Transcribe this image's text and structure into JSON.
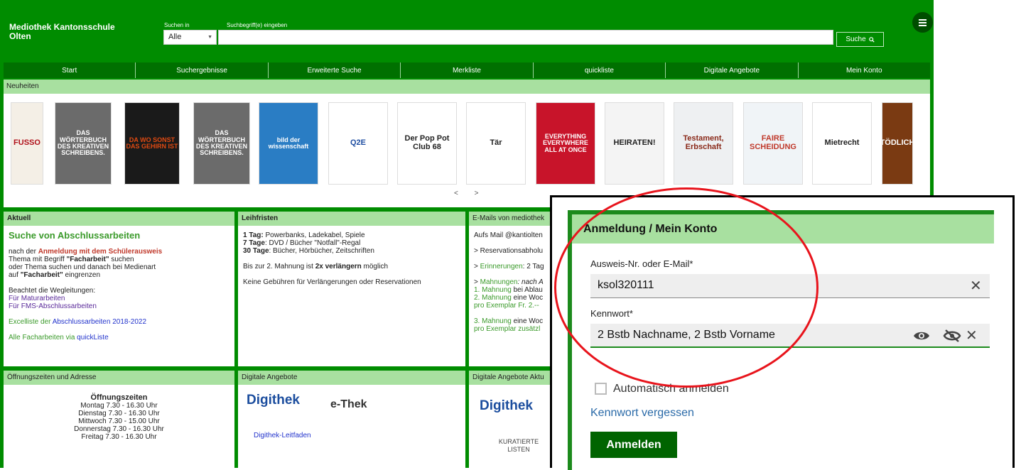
{
  "brand": "Mediothek Kantonsschule Olten",
  "search": {
    "scope_label": "Suchen in",
    "scope_value": "Alle",
    "term_label": "Suchbegriff(e) eingeben",
    "button": "Suche",
    "value": ""
  },
  "nav": [
    "Start",
    "Suchergebnisse",
    "Erweiterte Suche",
    "Merkliste",
    "quickliste",
    "Digitale Angebote",
    "Mein Konto"
  ],
  "neuheiten": {
    "title": "Neuheiten",
    "books": [
      {
        "text": "FUSSO",
        "bg": "#f4efe6",
        "fg": "#b0121c"
      },
      {
        "text": "DAS WÖRTERBUCH DES KREATIVEN SCHREIBENS.",
        "bg": "#6b6b6b",
        "fg": "#ffffff"
      },
      {
        "text": "DA WO SONST DAS GEHIRN IST",
        "bg": "#1a1a1a",
        "fg": "#e04a12"
      },
      {
        "text": "DAS WÖRTERBUCH DES KREATIVEN SCHREIBENS.",
        "bg": "#6b6b6b",
        "fg": "#ffffff"
      },
      {
        "text": "bild der wissenschaft",
        "bg": "#2a7dc4",
        "fg": "#ffffff"
      },
      {
        "text": "Q2E",
        "bg": "#ffffff",
        "fg": "#1e4da1"
      },
      {
        "text": "Der Pop Pot Club 68",
        "bg": "#ffffff",
        "fg": "#222222"
      },
      {
        "text": "Tär",
        "bg": "#ffffff",
        "fg": "#222222"
      },
      {
        "text": "EVERYTHING EVERYWHERE ALL AT ONCE",
        "bg": "#c8142a",
        "fg": "#ffffff"
      },
      {
        "text": "HEIRATEN!",
        "bg": "#f4f4f4",
        "fg": "#222222"
      },
      {
        "text": "Testament, Erbschaft",
        "bg": "#eef0f2",
        "fg": "#8a2a1a"
      },
      {
        "text": "FAIRE SCHEIDUNG",
        "bg": "#f0f4f7",
        "fg": "#c0392b"
      },
      {
        "text": "Mietrecht",
        "bg": "#ffffff",
        "fg": "#222222"
      },
      {
        "text": "TÖDLICH",
        "bg": "#7a3a12",
        "fg": "#ffffff"
      }
    ],
    "pager": "< >"
  },
  "aktuell": {
    "title": "Aktuell",
    "heading": "Suche von Abschlussarbeiten",
    "line1_pre": "nach der ",
    "line1_link": "Anmeldung mit dem Schülerausweis",
    "line2_pre": "Thema mit Begriff ",
    "line2_bold": "\"Facharbeit\"",
    "line2_post": " suchen",
    "line3": "oder Thema suchen und danach bei Medienart",
    "line4_pre": "auf ",
    "line4_bold": "\"Facharbeit\"",
    "line4_post": " eingrenzen",
    "wegleitungen": "Beachtet die Wegleitungen:",
    "link_matur": "Für Maturarbeiten",
    "link_fms": "Für FMS-Abschlussarbeiten",
    "excel_pre": "Excelliste der ",
    "excel_link": "Abschlussarbeiten 2018-2022",
    "alle_pre": "Alle Facharbeiten via ",
    "alle_link": "quickListe"
  },
  "leihfristen": {
    "title": "Leihfristen",
    "l1_bold": "1 Tag:",
    "l1": " Powerbanks, Ladekabel, Spiele",
    "l2_bold": "7 Tage",
    "l2": ": DVD / Bücher \"Notfall\"-Regal",
    "l3_bold": "30 Tage",
    "l3": ": Bücher, Hörbücher, Zeitschriften",
    "p2_pre": "Bis zur 2. Mahnung ist ",
    "p2_bold": "2x verlängern",
    "p2_post": " möglich",
    "p3": "Keine Gebühren für Verlängerungen oder Reservationen"
  },
  "emails": {
    "title": "E-Mails von mediothek",
    "l1": "Aufs Mail @kantiolten",
    "l2": "> Reservationsabholu",
    "l3_pre": "> ",
    "l3_link": "Erinnerungen",
    "l3_post": ": 2 Tag",
    "l4_pre": "> ",
    "l4_link": "Mahnungen",
    "l4_post": ": nach A",
    "l5_link": "1. Mahnung",
    "l5_post": " bei Ablau",
    "l6_link": "2. Mahnung",
    "l6_post": " eine Woc",
    "l7": "pro Exemplar Fr. 2.--",
    "l8_link": "3. Mahnung",
    "l8_post": " eine Woc",
    "l9": "pro Exemplar zusätzl"
  },
  "oeffnung": {
    "title": "Öffnungszeiten und Adresse",
    "heading": "Öffnungszeiten",
    "days": [
      "Montag 7.30 - 16.30 Uhr",
      "Dienstag 7.30 - 16.30 Uhr",
      "Mittwoch 7.30 - 15.00 Uhr",
      "Donnerstag 7.30 - 16.30 Uhr",
      "Freitag 7.30 - 16.30 Uhr"
    ]
  },
  "digital": {
    "title": "Digitale Angebote",
    "digithek": "Digithek",
    "ethek": "e-Thek",
    "leitfaden": "Digithek-Leitfaden"
  },
  "digital_aktuell": {
    "title": "Digitale Angebote Aktu",
    "digithek": "Digithek",
    "kuratierte": "KURATIERTE LISTEN"
  },
  "login": {
    "title": "Anmeldung / Mein Konto",
    "id_label": "Ausweis-Nr. oder E-Mail*",
    "id_value": "ksol320111",
    "pw_label": "Kennwort*",
    "pw_value": "2 Bstb Nachname, 2 Bstb Vorname",
    "auto_label": "Automatisch anmelden",
    "forgot": "Kennwort vergessen",
    "submit": "Anmelden"
  },
  "colors": {
    "brand_green": "#008c00",
    "nav_green": "#007000",
    "panel_header": "#a8e0a0",
    "highlight_circle": "#e8141c"
  }
}
